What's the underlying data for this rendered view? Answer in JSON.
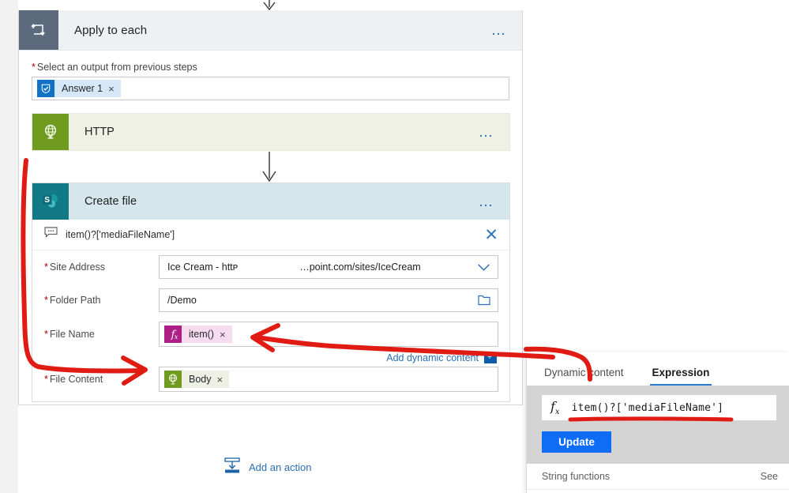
{
  "scope": {
    "title": "Apply to each",
    "icon": "loop-icon",
    "overflow_label": "…",
    "required_marker": "*",
    "output_field_label": "Select an output from previous steps",
    "output_token": {
      "label": "Answer 1",
      "icon": "forms-checkbox-icon",
      "remove": "×"
    }
  },
  "http_action": {
    "title": "HTTP",
    "icon": "globe-icon",
    "overflow_label": "…"
  },
  "sharepoint_action": {
    "title": "Create file",
    "icon": "sharepoint-icon",
    "overflow_label": "…",
    "comment": {
      "icon": "comment-icon",
      "text": "item()?['mediaFileName']",
      "close": "✕"
    },
    "fields": [
      {
        "label": "Site Address",
        "required": true,
        "type": "dropdown",
        "value_left": "Ice Cream - httᴘ",
        "value_right": "…point.com/sites/IceCream",
        "affix_icon": "chevron-down-icon"
      },
      {
        "label": "Folder Path",
        "required": true,
        "type": "text",
        "value": "/Demo",
        "affix_icon": "folder-picker-icon"
      },
      {
        "label": "File Name",
        "required": true,
        "type": "token",
        "token": {
          "label": "item()",
          "icon": "fx-expression-icon",
          "remove": "×",
          "style": "pink"
        }
      },
      {
        "label": "File Content",
        "required": true,
        "type": "token",
        "token": {
          "label": "Body",
          "icon": "globe-icon",
          "remove": "×",
          "style": "green"
        }
      }
    ],
    "dynamic_content_link": {
      "label": "Add dynamic content",
      "badge": "+"
    }
  },
  "add_action": {
    "label": "Add an action",
    "icon": "add-action-icon"
  },
  "expression_panel": {
    "tabs": [
      {
        "label": "Dynamic content",
        "active": false
      },
      {
        "label": "Expression",
        "active": true
      }
    ],
    "expression_input": {
      "prefix_icon": "fx-expression-icon",
      "value": "item()?['mediaFileName']"
    },
    "update_button": "Update",
    "sections": [
      {
        "title": "String functions",
        "link": "See"
      }
    ]
  },
  "annotations": {
    "color": "#e01b13",
    "arrows": [
      {
        "name": "arrow-http-body-to-file-content"
      },
      {
        "name": "arrow-expression-to-file-name"
      },
      {
        "name": "underline-expression-value"
      },
      {
        "name": "curve-to-dynamic-content"
      }
    ]
  }
}
